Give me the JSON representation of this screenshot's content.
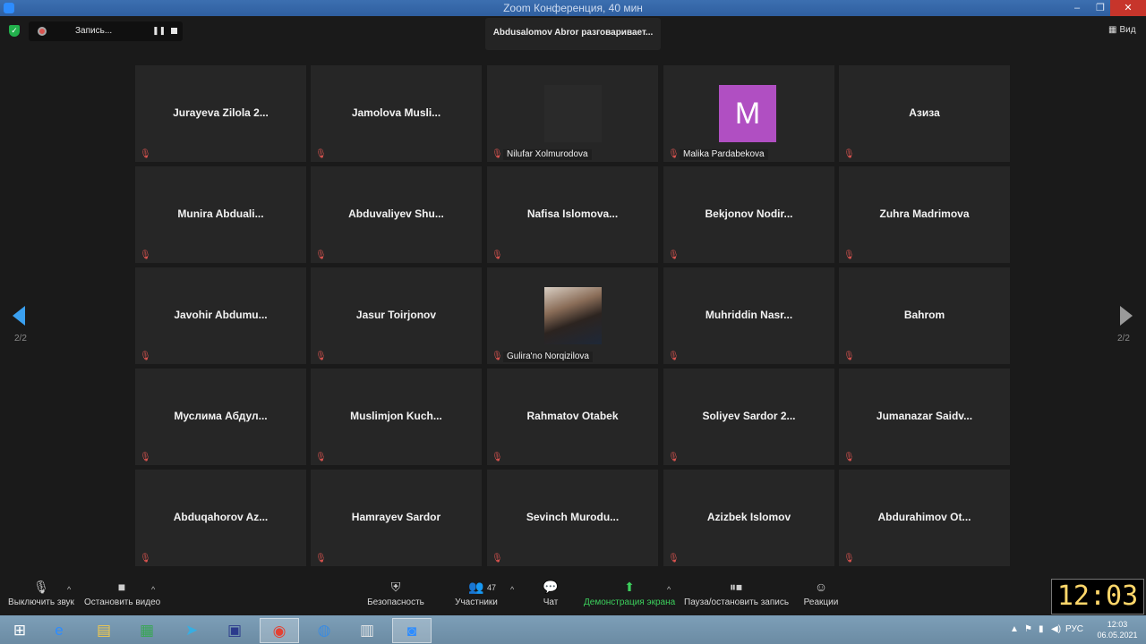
{
  "window": {
    "title": "Zoom Конференция, 40 мин",
    "minimize": "–",
    "maximize": "❐",
    "close": "✕"
  },
  "recording": {
    "label": "Запись...",
    "pause": "❚❚"
  },
  "speaker_banner": "Abdusalomov Abror разговаривает...",
  "view_button": {
    "icon": "▦",
    "label": "Вид"
  },
  "pager": {
    "page": "2/2"
  },
  "participants": [
    {
      "name": "Jurayeva Zilola 2...",
      "type": "name"
    },
    {
      "name": "Jamolova  Musli...",
      "type": "name"
    },
    {
      "name": "Nilufar Xolmurodova",
      "type": "blank"
    },
    {
      "name": "Malika Pardabekova",
      "type": "letter",
      "letter": "M"
    },
    {
      "name": "Азиза",
      "type": "name"
    },
    {
      "name": "Munira  Abduali...",
      "type": "name"
    },
    {
      "name": "Abduvaliyev  Shu...",
      "type": "name"
    },
    {
      "name": "Nafisa  Islomova...",
      "type": "name"
    },
    {
      "name": "Bekjonov  Nodir...",
      "type": "name"
    },
    {
      "name": "Zuhra Madrimova",
      "type": "name"
    },
    {
      "name": "Javohir  Abdumu...",
      "type": "name"
    },
    {
      "name": "Jasur Toirjonov",
      "type": "name"
    },
    {
      "name": "Gulira'no Norqizilova",
      "type": "photo"
    },
    {
      "name": "Muhriddin  Nasr...",
      "type": "name"
    },
    {
      "name": "Bahrom",
      "type": "name"
    },
    {
      "name": "Муслима  Абдул...",
      "type": "name"
    },
    {
      "name": "Muslimjon  Kuch...",
      "type": "name"
    },
    {
      "name": "Rahmatov Otabek",
      "type": "name"
    },
    {
      "name": "Soliyev Sardor 2...",
      "type": "name"
    },
    {
      "name": "Jumanazar  Saidv...",
      "type": "name"
    },
    {
      "name": "Abduqahorov  Az...",
      "type": "name"
    },
    {
      "name": "Hamrayev Sardor",
      "type": "name"
    },
    {
      "name": "Sevinch  Murodu...",
      "type": "name"
    },
    {
      "name": "Azizbek Islomov",
      "type": "name"
    },
    {
      "name": "Abdurahimov  Ot...",
      "type": "name"
    }
  ],
  "toolbar": {
    "mute": "Выключить звук",
    "video": "Остановить видео",
    "security": "Безопасность",
    "participants": "Участники",
    "participants_count": "47",
    "chat": "Чат",
    "share": "Демонстрация экрана",
    "record": "Пауза/остановить запись",
    "reactions": "Реакции",
    "caret": "^"
  },
  "clock": "12:03",
  "tray": {
    "lang": "РУС",
    "time": "12:03",
    "date": "06.05.2021"
  },
  "colors": {
    "accent_blue": "#2d8cff",
    "mic_muted": "#d9534f",
    "share_green": "#3ccf5c",
    "avatar_purple": "#b04fc2"
  }
}
